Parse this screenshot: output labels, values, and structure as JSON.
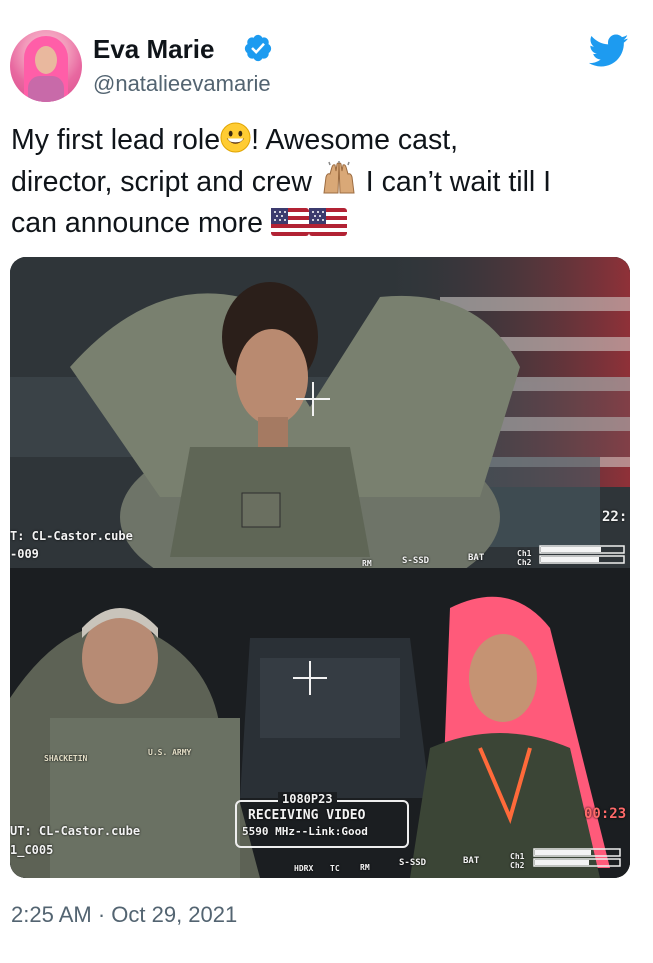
{
  "user": {
    "display_name": "Eva Marie",
    "handle": "@natalieevamarie",
    "verified_icon": "verified-badge-icon",
    "platform_icon": "twitter-bird-icon",
    "colors": {
      "verified": "#1d9bf0",
      "twitter": "#1d9bf0",
      "secondary_text": "#536471"
    }
  },
  "tweet": {
    "line1": "My first lead role",
    "line1b": "! Awesome cast,",
    "line2": "director, script and crew ",
    "line2b": " I can’t wait till I",
    "line3": "can announce more ",
    "emoji": [
      "grinning-face-emoji",
      "raising-hands-emoji",
      "us-flag-emoji",
      "us-flag-emoji"
    ]
  },
  "media": {
    "frame1": {
      "hud_left": "T: CL-Castor.cube",
      "hud_left2": "-009",
      "hud_right": "22:",
      "hud_ssd": "S-SSD",
      "hud_bat": "BAT",
      "hud_ch1": "Ch1",
      "hud_ch2": "Ch2",
      "hud_rm": "RM"
    },
    "frame2": {
      "resolution": "1080P23",
      "status": "RECEIVING VIDEO",
      "link": "5590 MHz--Link:Good",
      "hud_left": "UT: CL-Castor.cube",
      "hud_left2": "1_C005",
      "hud_right": "00:23",
      "hud_ssd": "S-SSD",
      "hud_bat": "BAT",
      "hud_ch1": "Ch1",
      "hud_ch2": "Ch2",
      "hud_tc": "TC",
      "hud_rm": "RM",
      "hud_hdrx": "HDRX",
      "patch_name": "SHACKETIN",
      "patch_army": "U.S. ARMY"
    }
  },
  "timestamp": "2:25 AM · Oct 29, 2021"
}
